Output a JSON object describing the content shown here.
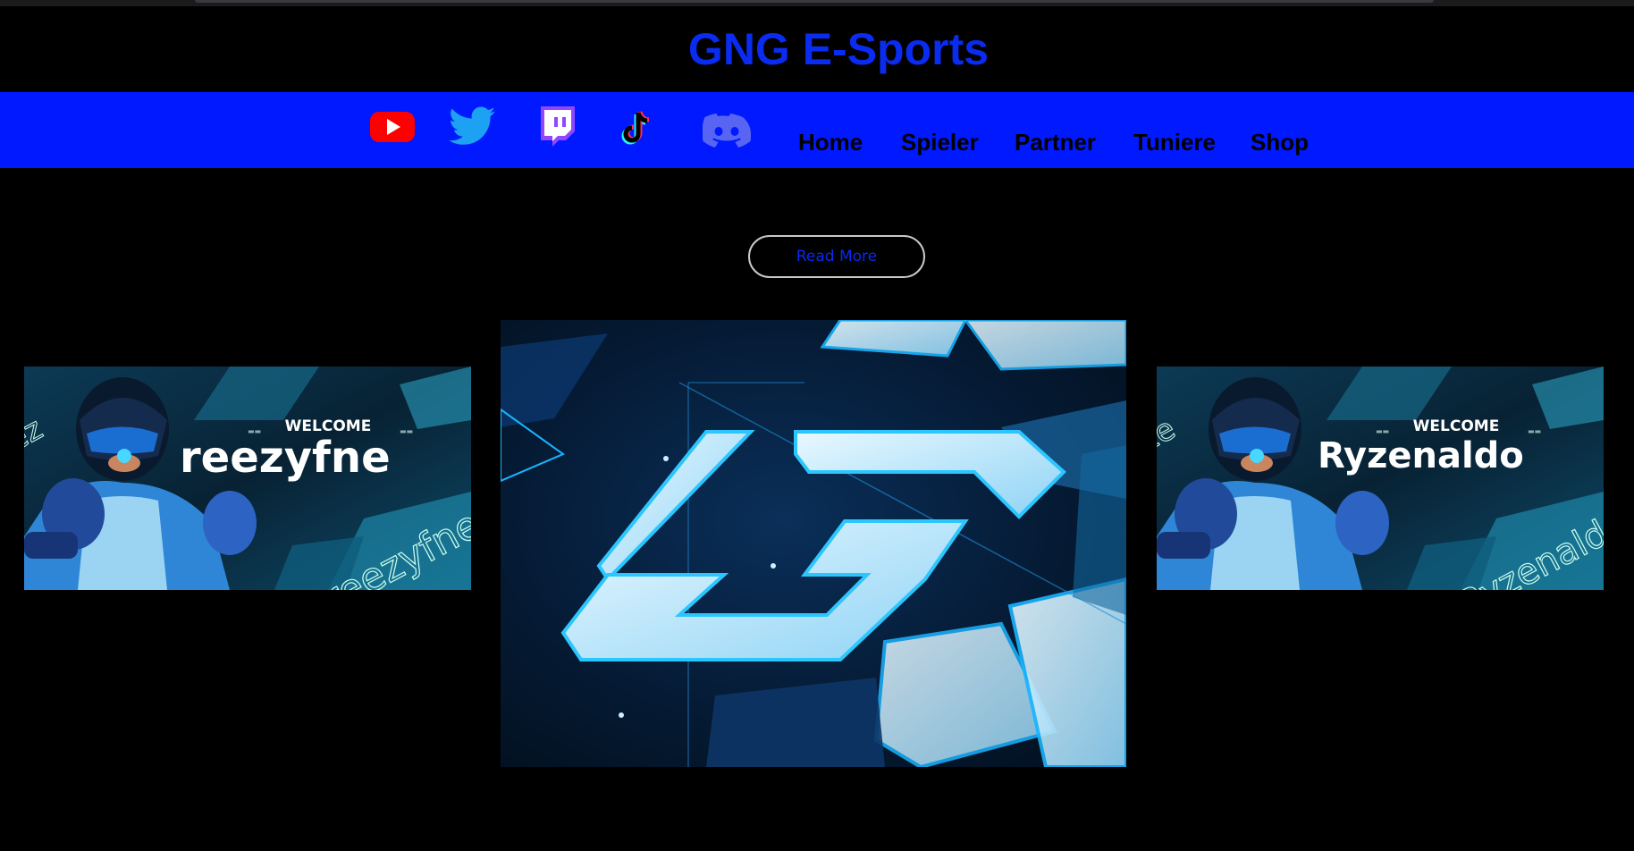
{
  "site": {
    "title": "GNG E-Sports"
  },
  "social_icons": [
    {
      "name": "youtube-icon",
      "color": "#ff0000"
    },
    {
      "name": "twitter-icon",
      "color": "#1da1f2"
    },
    {
      "name": "twitch-icon",
      "color": "#9146ff"
    },
    {
      "name": "tiktok-icon",
      "color": "#000000"
    },
    {
      "name": "discord-icon",
      "color": "#5865f2"
    }
  ],
  "nav": {
    "items": [
      "Home",
      "Spieler",
      "Partner",
      "Tuniere",
      "Shop"
    ]
  },
  "hero": {
    "read_more_label": "Read More"
  },
  "banners": {
    "left": {
      "welcome": "WELCOME",
      "player": "reezyfne",
      "watermark": "reezyfne"
    },
    "right": {
      "welcome": "WELCOME",
      "player": "Ryzenaldo",
      "watermark": "Ryzenaldo"
    }
  },
  "colors": {
    "accent": "#0019ff",
    "title": "#0a2bf0",
    "background": "#000000"
  }
}
